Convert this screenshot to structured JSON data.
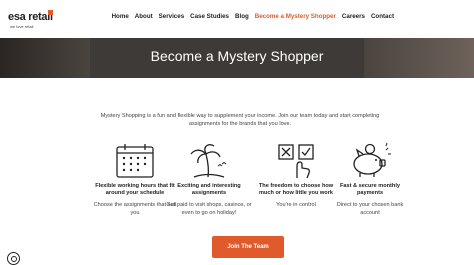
{
  "header": {
    "logo_text": "esa retail",
    "logo_sub": "we love retail",
    "nav": [
      "Home",
      "About",
      "Services",
      "Case Studies",
      "Blog",
      "Become a Mystery Shopper",
      "Careers",
      "Contact"
    ],
    "active_color": "#e05a2b"
  },
  "hero": {
    "title": "Become a Mystery Shopper"
  },
  "intro": "Mystery Shopping is a fun and flexible way to supplement your income. Join our team today and start completing assignments for the brands that you love.",
  "features": [
    {
      "icon": "calendar-icon",
      "title": "Flexible working hours that fit around your schedule",
      "desc": "Choose the assignments that suit you"
    },
    {
      "icon": "palm-tree-icon",
      "title": "Exciting and interesting assignments",
      "desc": "Get paid to visit shops, casinos, or even to go on holiday!"
    },
    {
      "icon": "checklist-hand-icon",
      "title": "The freedom to choose how much or how little you work",
      "desc": "You're in control"
    },
    {
      "icon": "piggy-bank-icon",
      "title": "Fast & secure monthly payments",
      "desc": "Direct to your chosen bank account"
    }
  ],
  "cta": {
    "label": "Join The Team"
  }
}
